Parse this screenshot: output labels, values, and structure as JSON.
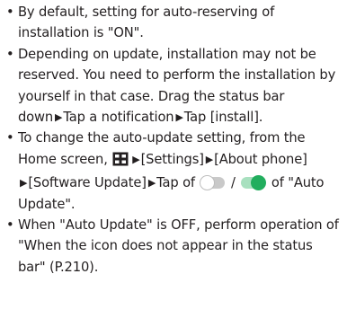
{
  "bullets": [
    {
      "text": "By default, setting for auto-reserving of installation is \"ON\"."
    },
    {
      "text_before": "Depending on update, installation may not be reserved. You need to perform the installation by yourself in that case. Drag the status bar down",
      "arrow": "▶",
      "step2": "Tap a notification",
      "step3": "Tap [install]."
    },
    {
      "text_before": "To change the auto-update setting, from the Home screen,",
      "grid_icon": "apps-grid-icon",
      "arrow": "▶",
      "step_settings": "[Settings]",
      "step_about": "[About phone]",
      "step_software": "[Software Update]",
      "tap_of": "Tap of",
      "slash": "/",
      "of_auto": "of \"Auto Update\".",
      "toggle_off_icon": "toggle-off-icon",
      "toggle_on_icon": "toggle-on-icon",
      "accent_color": "#22ae5e"
    },
    {
      "text": "When \"Auto Update\" is OFF, perform operation of \"When the icon does not appear in the status bar\" (P.210)."
    }
  ]
}
